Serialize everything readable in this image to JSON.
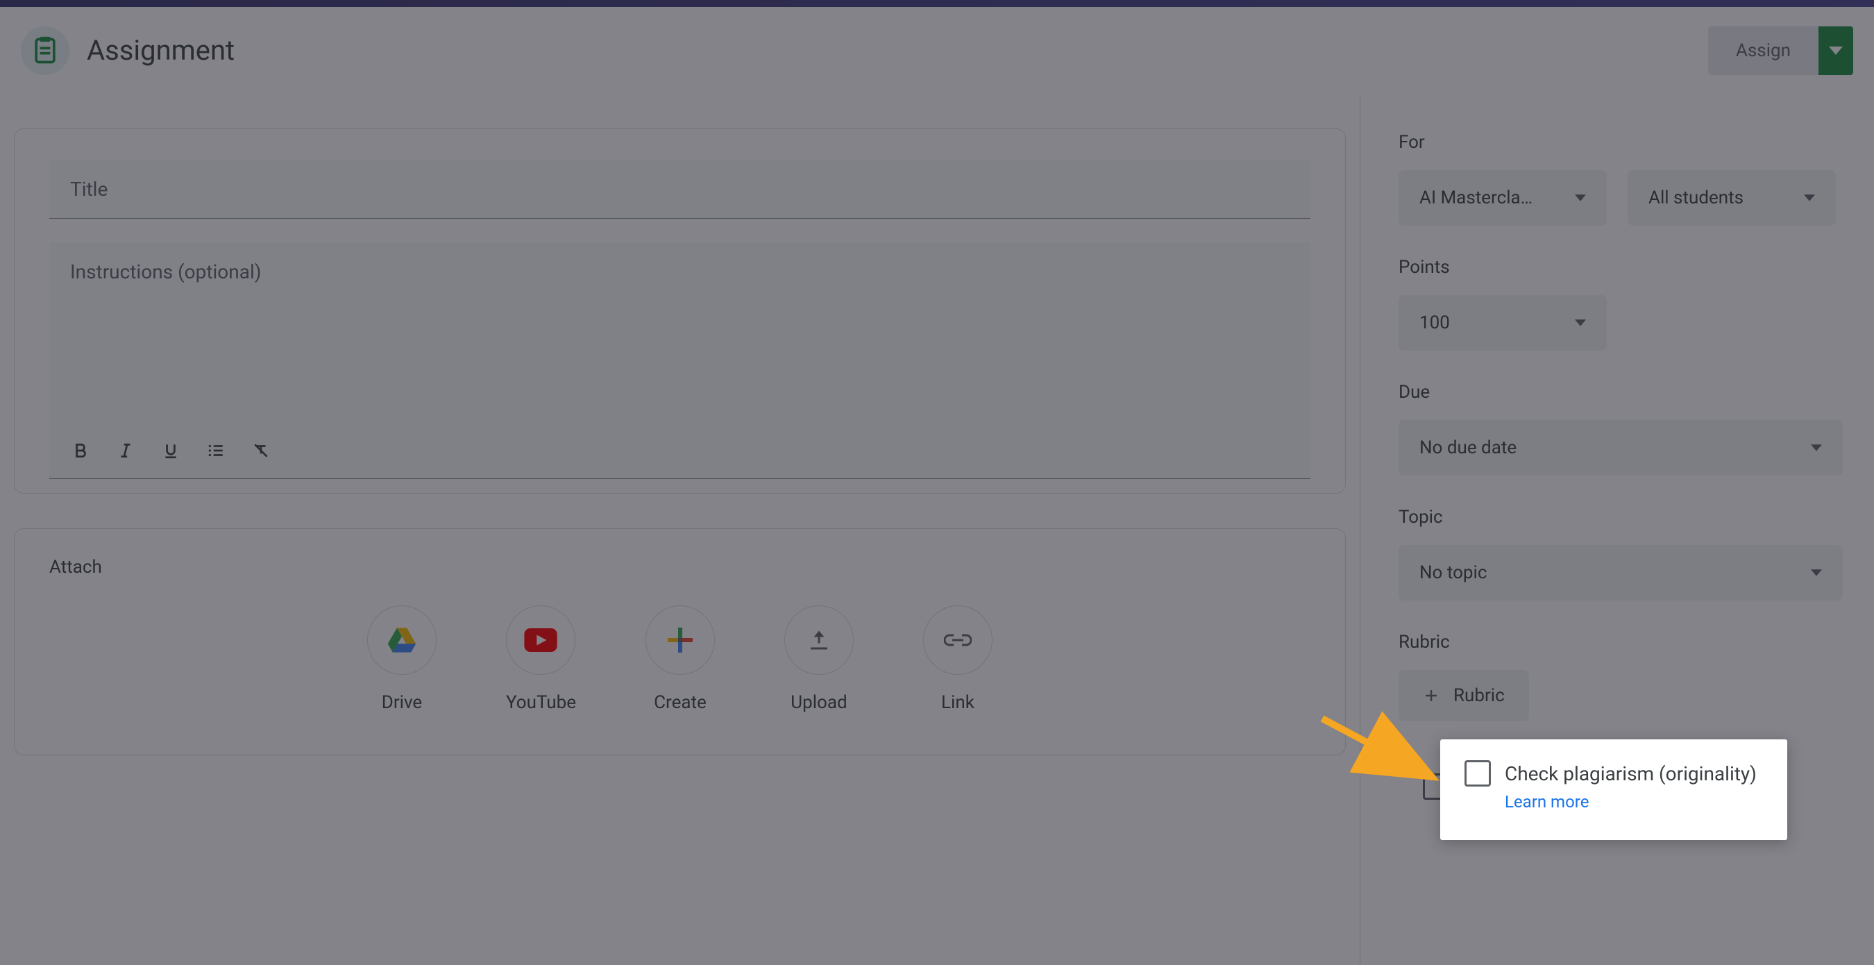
{
  "header": {
    "title": "Assignment",
    "assign_button": "Assign"
  },
  "editor": {
    "title_placeholder": "Title",
    "instructions_placeholder": "Instructions (optional)"
  },
  "attach": {
    "label": "Attach",
    "items": [
      {
        "label": "Drive"
      },
      {
        "label": "YouTube"
      },
      {
        "label": "Create"
      },
      {
        "label": "Upload"
      },
      {
        "label": "Link"
      }
    ]
  },
  "sidebar": {
    "for": {
      "label": "For",
      "class_value": "AI Mastercla…",
      "students_value": "All students"
    },
    "points": {
      "label": "Points",
      "value": "100"
    },
    "due": {
      "label": "Due",
      "value": "No due date"
    },
    "topic": {
      "label": "Topic",
      "value": "No topic"
    },
    "rubric": {
      "label": "Rubric",
      "button": "Rubric"
    },
    "plagiarism": {
      "label": "Check plagiarism (originality)",
      "learn_more": "Learn more"
    }
  }
}
